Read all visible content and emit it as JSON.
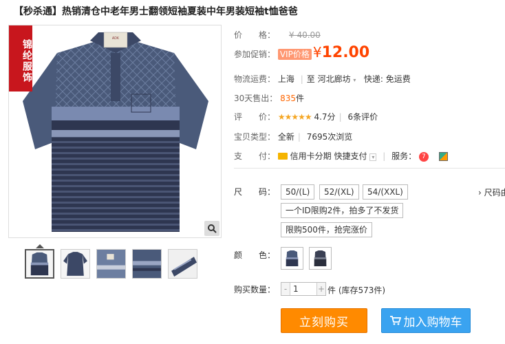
{
  "title": "【秒杀通】热销清仓中老年男士翻领短袖夏装中年男装短袖t恤爸爸",
  "gallery": {
    "ribbon_text": "锦纶服饰",
    "brand_tag": "ADK",
    "thumb_count": 5
  },
  "price": {
    "label": "价　　格：",
    "original": "¥ 40.00"
  },
  "promo": {
    "label": "参加促销：",
    "badge": "VIP价格",
    "currency": "¥",
    "value": "12.00"
  },
  "shipping": {
    "label": "物流运费：",
    "from": "上海",
    "to_sep": "至",
    "to": "河北廊坊",
    "method": "快递: 免运费"
  },
  "sales": {
    "label": "30天售出：",
    "count": "835",
    "unit": "件"
  },
  "rating": {
    "label": "评　　价：",
    "stars": "★★★★★",
    "score": "4.7分",
    "reviews": "6条评价"
  },
  "condition": {
    "label": "宝贝类型：",
    "value": "全新",
    "views": "7695次浏览"
  },
  "payment": {
    "label": "支　　付：",
    "installment": "信用卡分期",
    "quickpay": "快捷支付",
    "service_label": "服务："
  },
  "size": {
    "label": "尺　　码：",
    "options": [
      "50/(L)",
      "52/(XL)",
      "54/(XXL)"
    ],
    "chart_link": "› 尺码由",
    "notices": [
      "一个ID限购2件，拍多了不发货",
      "限购500件，抢完涨价"
    ]
  },
  "color": {
    "label": "颜　　色："
  },
  "quantity": {
    "label": "购买数量：",
    "value": "1",
    "stock": "件 (库存573件)"
  },
  "buttons": {
    "buy": "立刻购买",
    "cart": "加入购物车"
  },
  "colors": {
    "accent": "#ff4400",
    "buy": "#ff8a00",
    "cart": "#3aa3f0"
  }
}
